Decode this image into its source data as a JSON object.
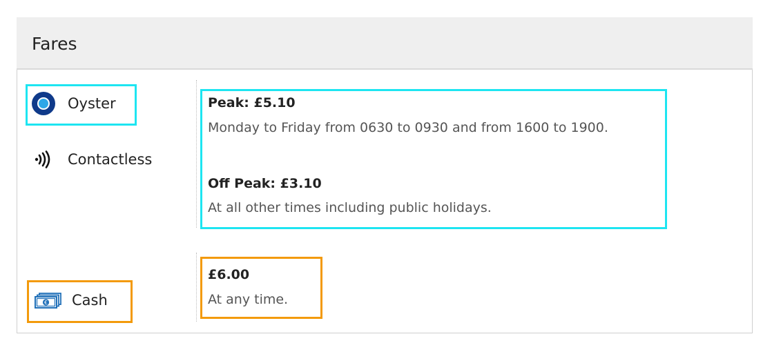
{
  "header": {
    "title": "Fares"
  },
  "payment_methods": {
    "oyster": {
      "label": "Oyster",
      "icon": "oyster-radio-icon"
    },
    "contactless": {
      "label": "Contactless",
      "icon": "contactless-icon"
    },
    "cash": {
      "label": "Cash",
      "icon": "cash-icon"
    }
  },
  "fares": {
    "peak": {
      "title": "Peak: £5.10",
      "description": "Monday to Friday from 0630 to 0930 and from 1600 to 1900."
    },
    "off_peak": {
      "title": "Off Peak: £3.10",
      "description": "At all other times including public holidays."
    },
    "cash": {
      "title": "£6.00",
      "description": "At any time."
    }
  },
  "colors": {
    "highlight_cyan": "#1de5f1",
    "highlight_orange": "#f39a0b",
    "radio_fill": "#0f3a8a",
    "radio_dot": "#2ea7e8",
    "cash_icon": "#1f6fb8"
  }
}
